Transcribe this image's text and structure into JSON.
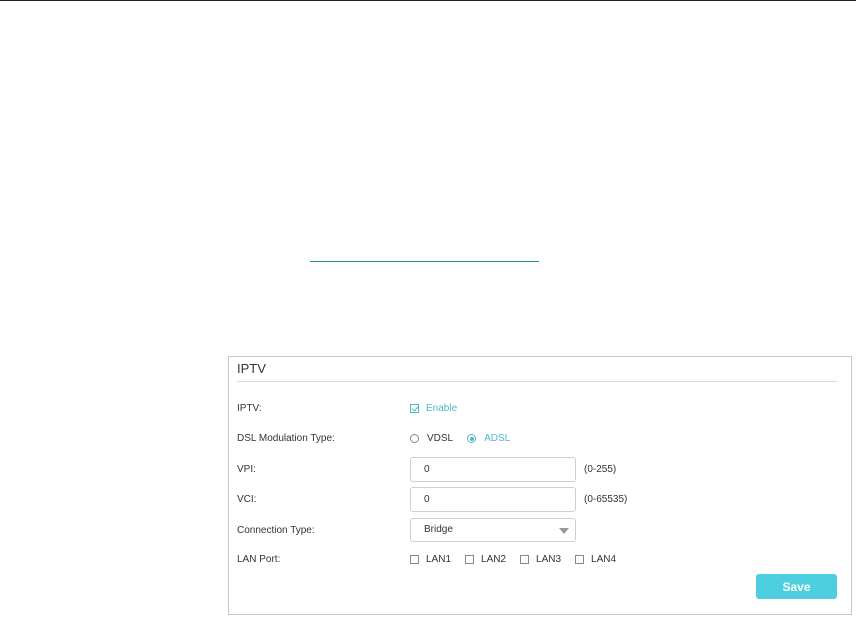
{
  "panel": {
    "title": "IPTV",
    "iptv": {
      "label": "IPTV:",
      "enable_label": "Enable",
      "enabled": true
    },
    "dsl": {
      "label": "DSL Modulation Type:",
      "options": [
        {
          "label": "VDSL",
          "selected": false
        },
        {
          "label": "ADSL",
          "selected": true
        }
      ]
    },
    "vpi": {
      "label": "VPI:",
      "value": "0",
      "range": "(0-255)"
    },
    "vci": {
      "label": "VCI:",
      "value": "0",
      "range": "(0-65535)"
    },
    "connection": {
      "label": "Connection Type:",
      "value": "Bridge"
    },
    "lan": {
      "label": "LAN Port:",
      "ports": [
        {
          "label": "LAN1",
          "checked": false
        },
        {
          "label": "LAN2",
          "checked": false
        },
        {
          "label": "LAN3",
          "checked": false
        },
        {
          "label": "LAN4",
          "checked": false
        }
      ]
    },
    "save_label": "Save"
  },
  "colors": {
    "accent": "#4fb7c8",
    "button": "#4dcfe0",
    "link_line": "#2a8a96"
  }
}
